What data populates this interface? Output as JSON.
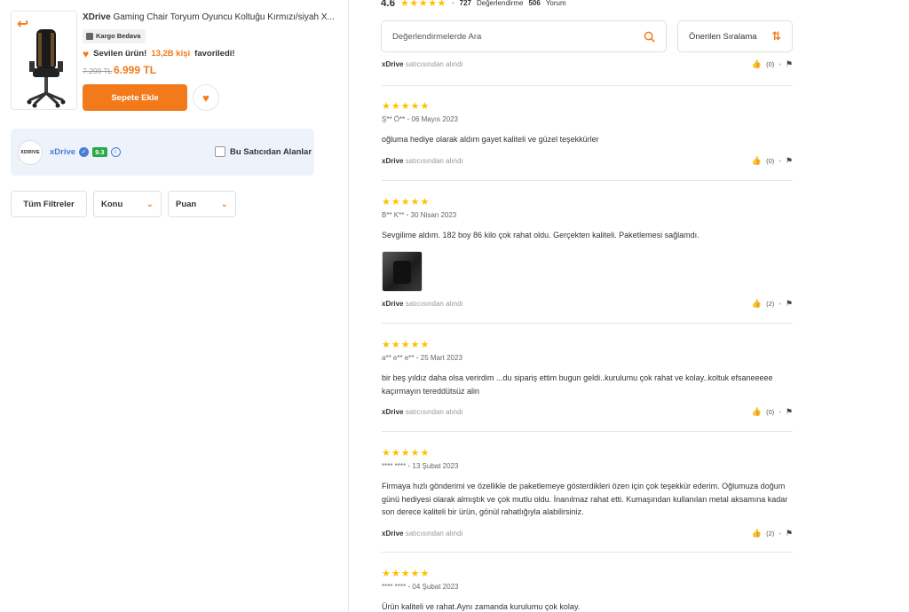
{
  "product": {
    "brand": "XDrive",
    "title": " Gaming Chair Toryum Oyuncu Koltuğu Kırmızı/siyah X...",
    "cargo_badge": "Kargo Bedava",
    "fav_prefix": "Sevilen ürün!",
    "fav_count": "13,2B kişi",
    "fav_suffix": "favoriledi!",
    "old_price": "7.299 TL",
    "new_price": "6.999 TL",
    "add_to_cart": "Sepete Ekle"
  },
  "seller": {
    "logo_text": "XDRIVE",
    "name": "xDrive",
    "score": "9.3",
    "only_this_seller": "Bu Satıcıdan Alanlar"
  },
  "filters": {
    "all": "Tüm Filtreler",
    "topic": "Konu",
    "rating": "Puan"
  },
  "summary": {
    "average": "4.6",
    "stars": "★★★★★",
    "rating_count": "727",
    "rating_label": "Değerlendirme",
    "comment_count": "506",
    "comment_label": "Yorum"
  },
  "search": {
    "placeholder": "Değerlendirmelerde Ara"
  },
  "sort": {
    "label": "Önerilen Sıralama"
  },
  "seller_suffix": "satıcısından alındı",
  "partial_top": {
    "seller": "xDrive",
    "likes": "(0)"
  },
  "reviews": [
    {
      "stars": "★★★★★",
      "user": "Ş** Ö**",
      "date": "06 Mayıs 2023",
      "text": "oğluma hediye olarak aldım gayet kaliteli ve güzel teşekkürler",
      "seller": "xDrive",
      "likes": "(0)",
      "has_photo": false
    },
    {
      "stars": "★★★★★",
      "user": "B** K**",
      "date": "30 Nisan 2023",
      "text": "Sevgilime aldım. 182 boy 86 kilo çok rahat oldu. Gerçekten kaliteli. Paketlemesi sağlamdı.",
      "seller": "xDrive",
      "likes": "(2)",
      "has_photo": true
    },
    {
      "stars": "★★★★★",
      "user": "a** e** e**",
      "date": "25 Mart 2023",
      "text": "bir beş yıldız daha olsa verirdim ...du sipariş ettim bugun geldi..kurulumu çok rahat ve kolay..koltuk efsaneeeee kaçırmayın tereddütsüz alin",
      "seller": "xDrive",
      "likes": "(0)",
      "has_photo": false
    },
    {
      "stars": "★★★★★",
      "user": "**** ****",
      "date": "13 Şubat 2023",
      "text": "Firmaya hızlı gönderimi ve özellikle de paketlemeye gösterdikleri özen için çok teşekkür ederim. Oğlumuza doğum günü hediyesi olarak almıştık ve çok mutlu oldu. İnanılmaz rahat etti. Kumaşından kullanılan metal aksamına kadar son derece kaliteli bir ürün, gönül rahatlığıyla alabilirsiniz.",
      "seller": "xDrive",
      "likes": "(2)",
      "has_photo": false
    },
    {
      "stars": "★★★★★",
      "user": "**** ****",
      "date": "04 Şubat 2023",
      "text": "Ürün kaliteli ve rahat.Aynı zamanda kurulumu çok kolay.",
      "seller": "",
      "likes": "",
      "has_photo": false
    }
  ]
}
